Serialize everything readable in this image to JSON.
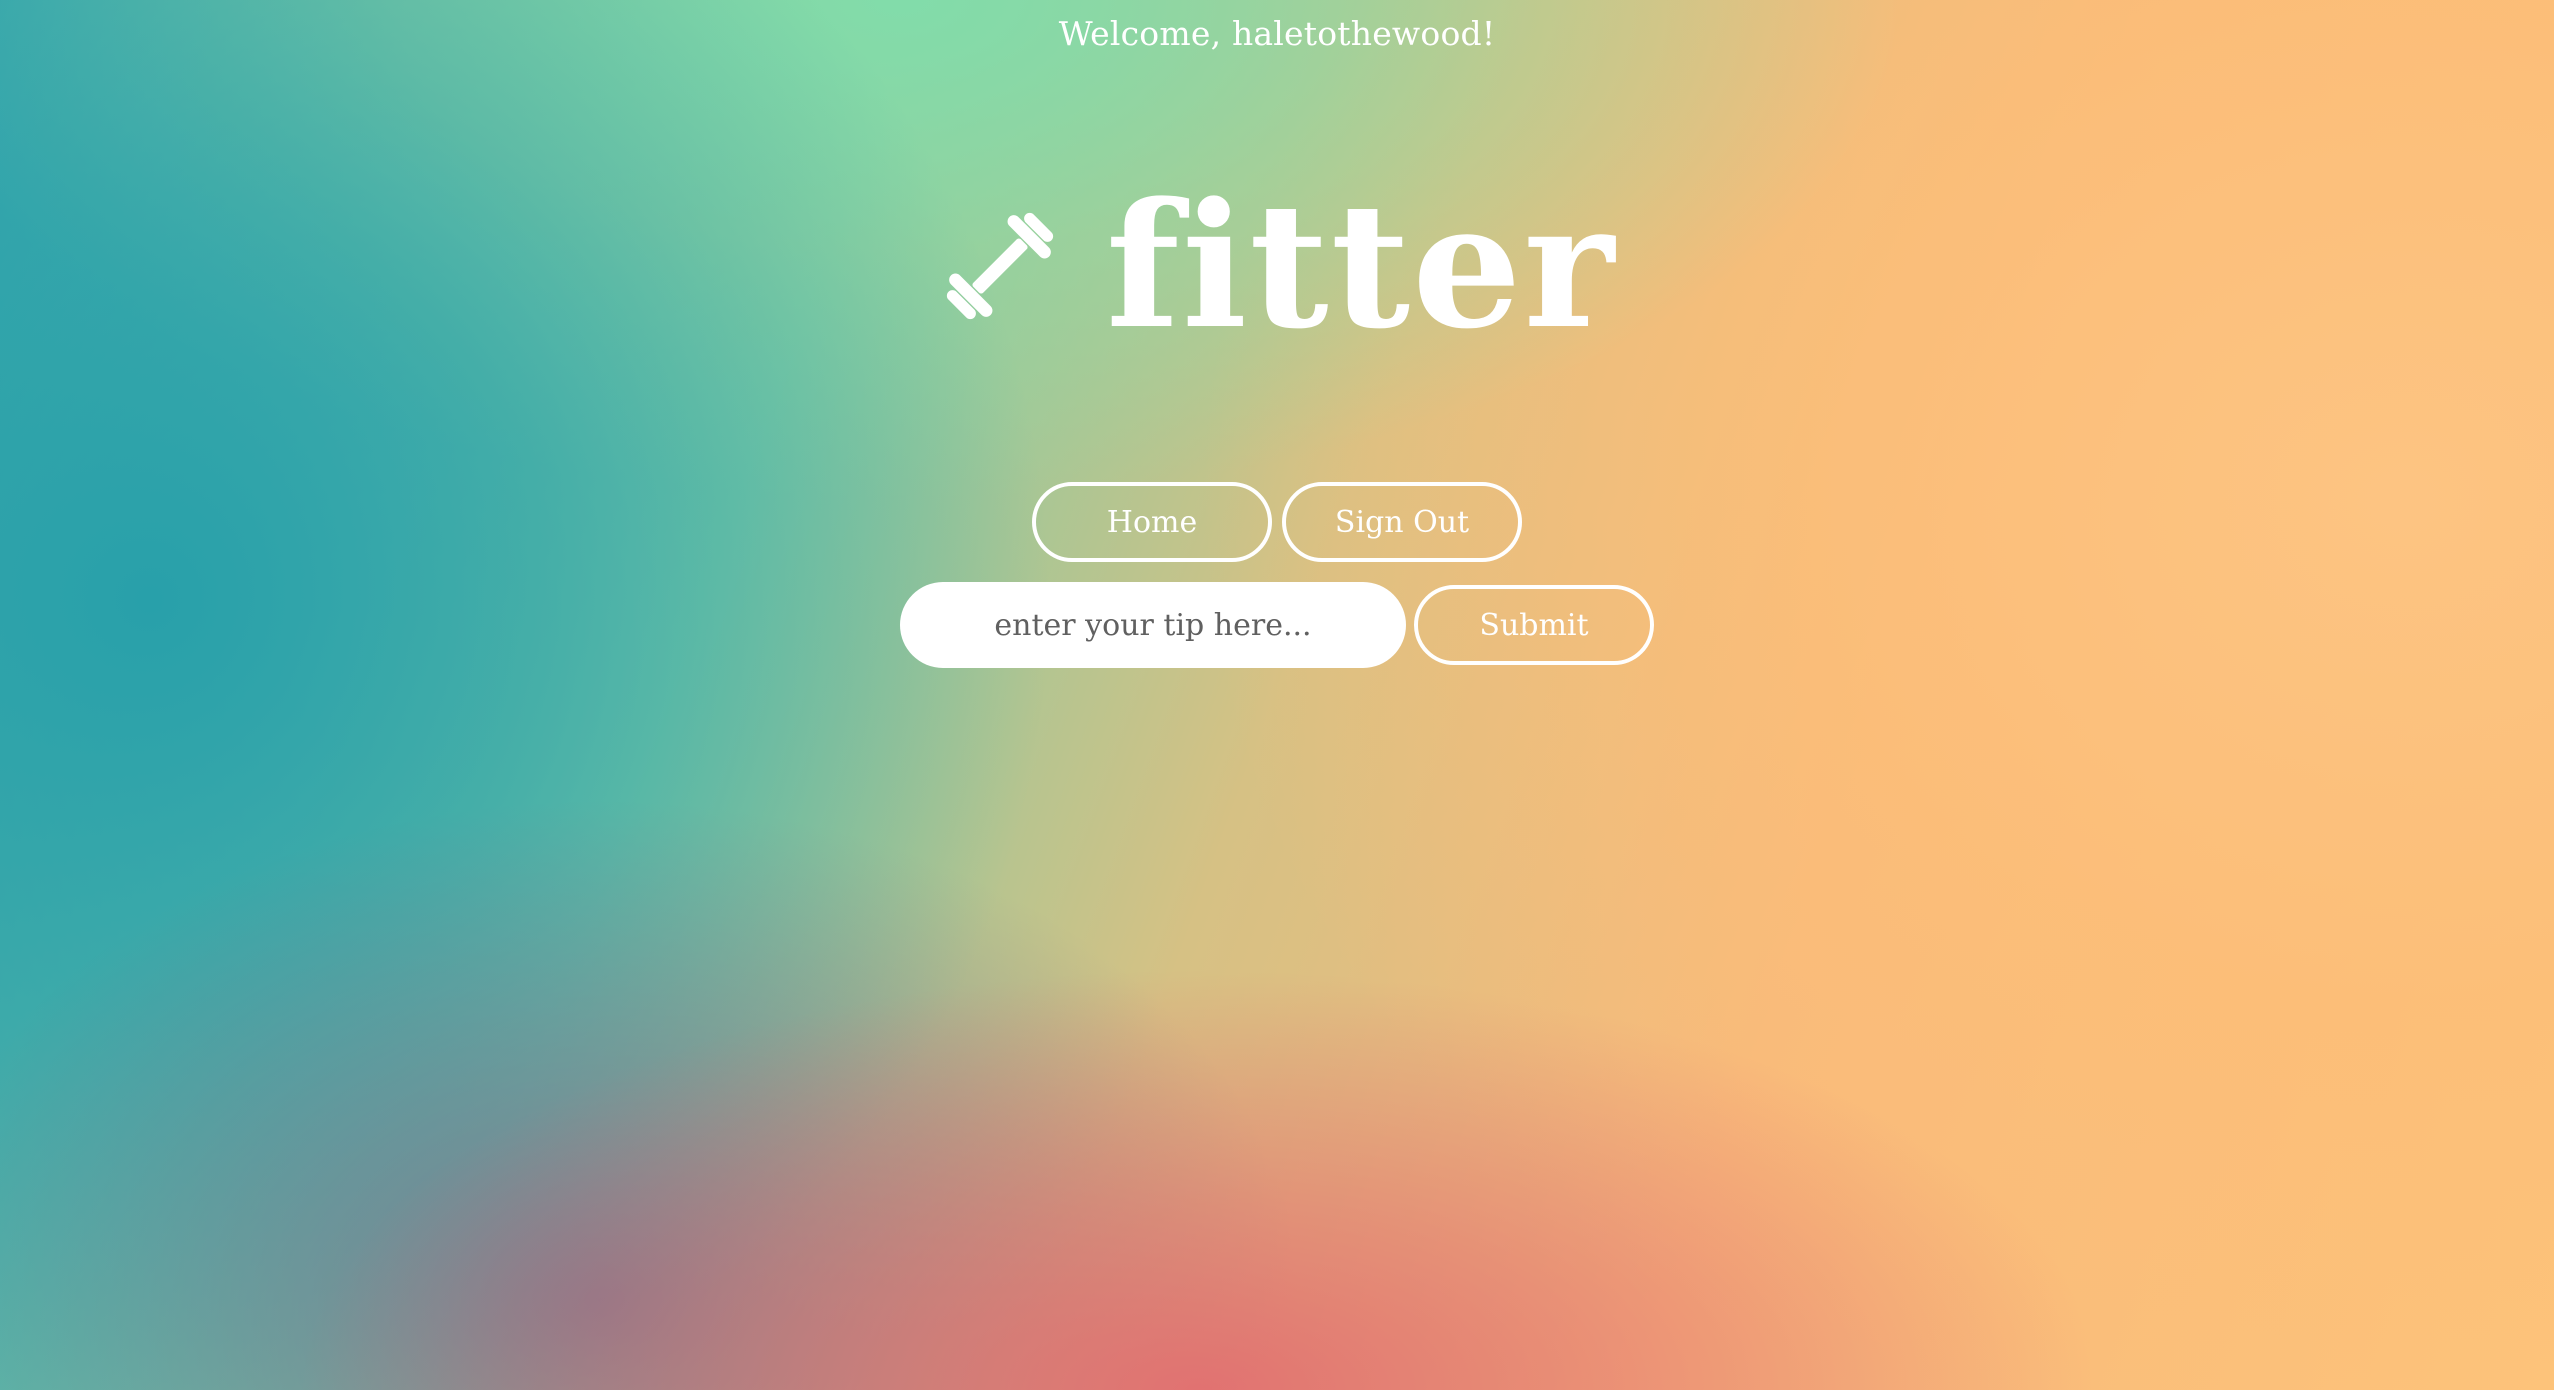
{
  "header": {
    "welcome_text": "Welcome, haletothewood!"
  },
  "logo": {
    "icon": "dumbbell-icon",
    "wordmark": "fitter"
  },
  "nav": {
    "home_label": "Home",
    "sign_out_label": "Sign Out"
  },
  "tip_form": {
    "placeholder": "enter your tip here...",
    "value": "",
    "submit_label": "Submit"
  },
  "colors": {
    "text": "#ffffff",
    "input_background": "#ffffff",
    "placeholder_text": "#606060",
    "gradient_teal": "#3aa8ae",
    "gradient_mint": "#82dcaa",
    "gradient_peach": "#fdc47a",
    "gradient_coral": "#e26e70"
  }
}
